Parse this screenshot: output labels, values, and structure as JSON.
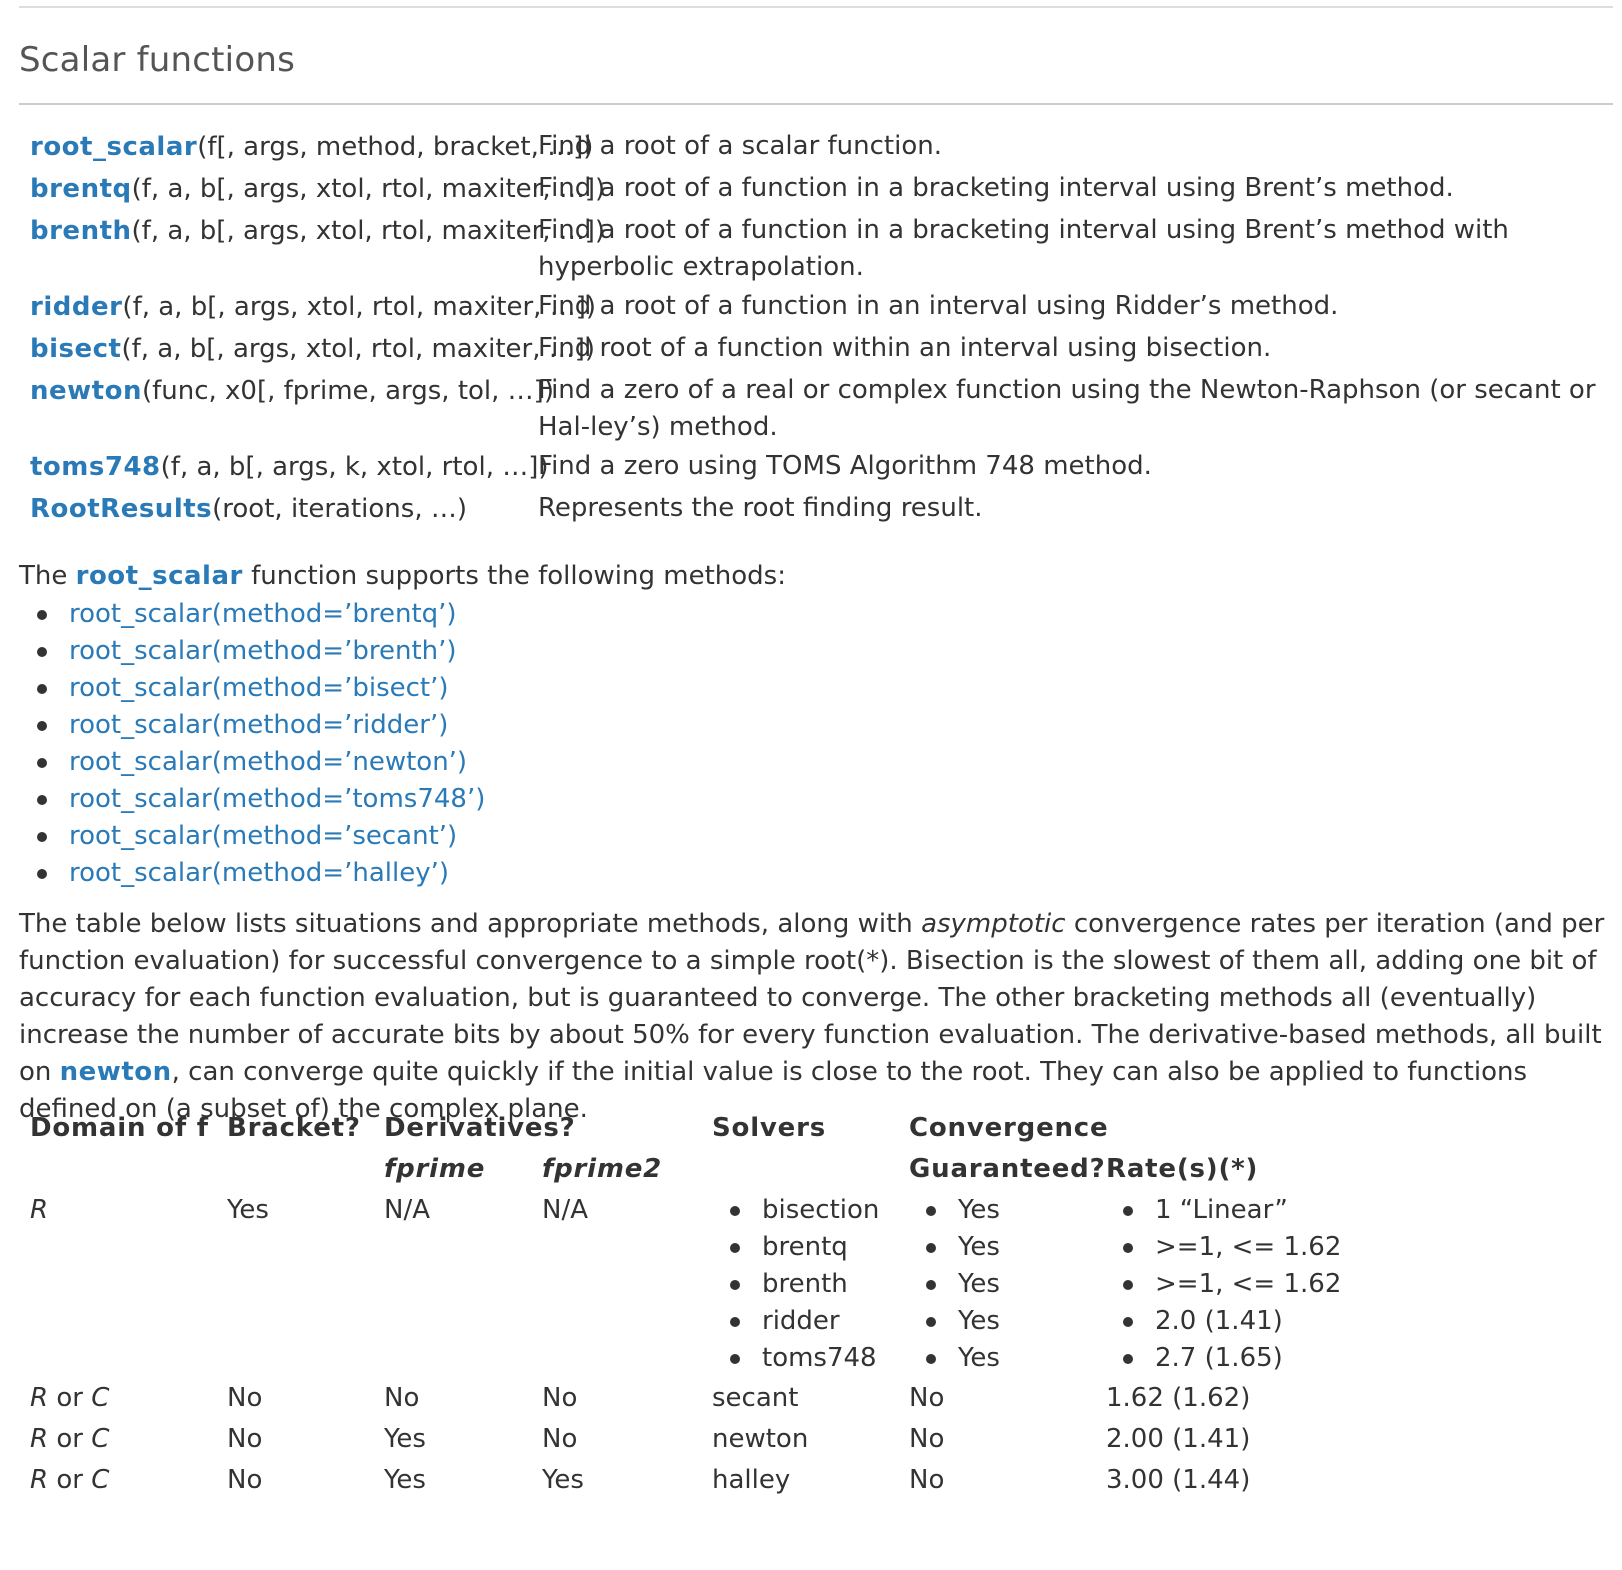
{
  "section": {
    "title": "Scalar functions"
  },
  "functions": [
    {
      "name": "root_scalar",
      "args": "(f[, args, method, bracket, …])",
      "desc": "Find a root of a scalar function."
    },
    {
      "name": "brentq",
      "args": "(f, a, b[, args, xtol, rtol, maxiter, …])",
      "desc": "Find a root of a function in a bracketing interval using Brent’s method."
    },
    {
      "name": "brenth",
      "args": "(f, a, b[, args, xtol, rtol, maxiter, …])",
      "desc": "Find a root of a function in a bracketing interval using Brent’s method with hyperbolic extrapolation."
    },
    {
      "name": "ridder",
      "args": "(f, a, b[, args, xtol, rtol, maxiter, …])",
      "desc": "Find a root of a function in an interval using Ridder’s method."
    },
    {
      "name": "bisect",
      "args": "(f, a, b[, args, xtol, rtol, maxiter, …])",
      "desc": "Find root of a function within an interval using bisection."
    },
    {
      "name": "newton",
      "args": "(func, x0[, fprime, args, tol, …])",
      "desc": "Find a zero of a real or complex function using the Newton-Raphson (or secant or Hal-ley’s) method."
    },
    {
      "name": "toms748",
      "args": "(f, a, b[, args, k, xtol, rtol, …])",
      "desc": "Find a zero using TOMS Algorithm 748 method."
    },
    {
      "name": "RootResults",
      "args": "(root, iterations, …)",
      "desc": "Represents the root finding result."
    }
  ],
  "methods_intro": {
    "before": "The ",
    "link": "root_scalar",
    "after": " function supports the following methods:"
  },
  "methods": [
    "root_scalar(method=’brentq’)",
    "root_scalar(method=’brenth’)",
    "root_scalar(method=’bisect’)",
    "root_scalar(method=’ridder’)",
    "root_scalar(method=’newton’)",
    "root_scalar(method=’toms748’)",
    "root_scalar(method=’secant’)",
    "root_scalar(method=’halley’)"
  ],
  "table_intro": {
    "part1": "The table below lists situations and appropriate methods, along with ",
    "em": "asymptotic",
    "part2": " convergence rates per iteration (and per function evaluation) for successful convergence to a simple root(*). Bisection is the slowest of them all, adding one bit of accuracy for each function evaluation, but is guaranteed to converge. The other bracketing methods all (eventually) increase the number of accurate bits by about 50% for every function evaluation. The derivative-based methods, all built on ",
    "link": "newton",
    "part3": ", can converge quite quickly if the initial value is close to the root. They can also be applied to functions defined on (a subset of) the complex plane."
  },
  "table": {
    "headers": {
      "domain": "Domain of f",
      "bracket": "Bracket?",
      "derivatives": "Derivatives?",
      "fprime": "fprime",
      "fprime2": "fprime2",
      "solvers": "Solvers",
      "convergence": "Convergence",
      "guaranteed": "Guaranteed?",
      "rates": "Rate(s)(*)"
    },
    "bracketing_row": {
      "domain": "R",
      "bracket": "Yes",
      "fprime": "N/A",
      "fprime2": "N/A",
      "solvers": [
        "bisection",
        "brentq",
        "brenth",
        "ridder",
        "toms748"
      ],
      "guaranteed": [
        "Yes",
        "Yes",
        "Yes",
        "Yes",
        "Yes"
      ],
      "rates": [
        "1 “Linear”",
        ">=1, <= 1.62",
        ">=1, <= 1.62",
        "2.0 (1.41)",
        "2.7 (1.65)"
      ]
    },
    "rows": [
      {
        "domain_r": "R",
        "domain_or": " or ",
        "domain_c": "C",
        "bracket": "No",
        "fprime": "No",
        "fprime2": "No",
        "solver": "secant",
        "guaranteed": "No",
        "rate": "1.62 (1.62)"
      },
      {
        "domain_r": "R",
        "domain_or": " or ",
        "domain_c": "C",
        "bracket": "No",
        "fprime": "Yes",
        "fprime2": "No",
        "solver": "newton",
        "guaranteed": "No",
        "rate": "2.00 (1.41)"
      },
      {
        "domain_r": "R",
        "domain_or": " or ",
        "domain_c": "C",
        "bracket": "No",
        "fprime": "Yes",
        "fprime2": "Yes",
        "solver": "halley",
        "guaranteed": "No",
        "rate": "3.00 (1.44)"
      }
    ]
  }
}
